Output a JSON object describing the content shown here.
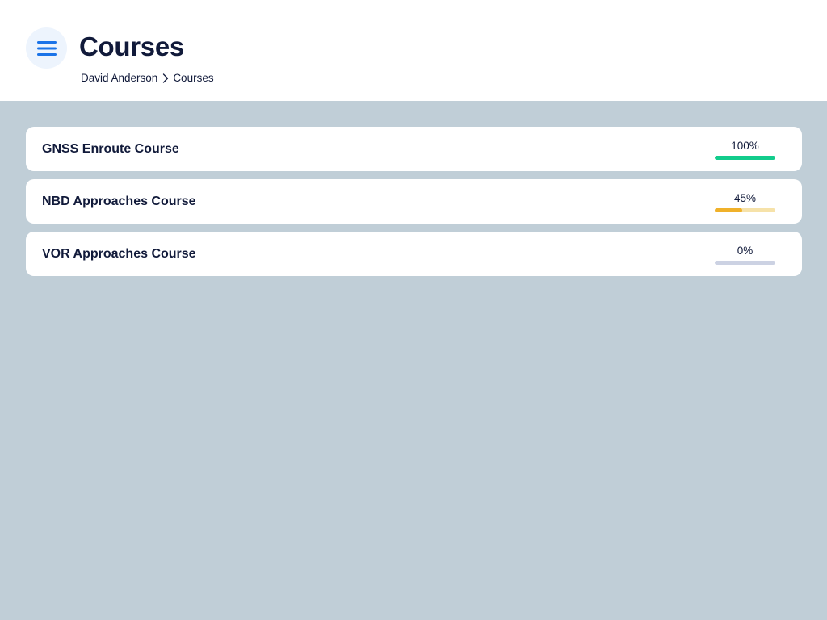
{
  "header": {
    "title": "Courses",
    "menu_icon": "hamburger-menu-icon",
    "breadcrumb": {
      "items": [
        "David Anderson",
        "Courses"
      ],
      "separator_icon": "chevron-right-icon"
    }
  },
  "courses": [
    {
      "name": "GNSS Enroute Course",
      "progress_label": "100%",
      "progress_fraction": 1.0,
      "fill_color": "#12cc8c",
      "track_color": "#a4eccf"
    },
    {
      "name": "NBD Approaches Course",
      "progress_label": "45%",
      "progress_fraction": 0.45,
      "fill_color": "#f0b12a",
      "track_color": "#f6e2a9"
    },
    {
      "name": "VOR Approaches Course",
      "progress_label": "0%",
      "progress_fraction": 0.0,
      "fill_color": "#b7bfd9",
      "track_color": "#ccd2e3"
    }
  ],
  "colors": {
    "background": "#c0ced7",
    "header_background": "#ffffff",
    "menu_button_bg": "#edf4fd",
    "menu_icon": "#1a73e8",
    "text": "#111a3a"
  }
}
